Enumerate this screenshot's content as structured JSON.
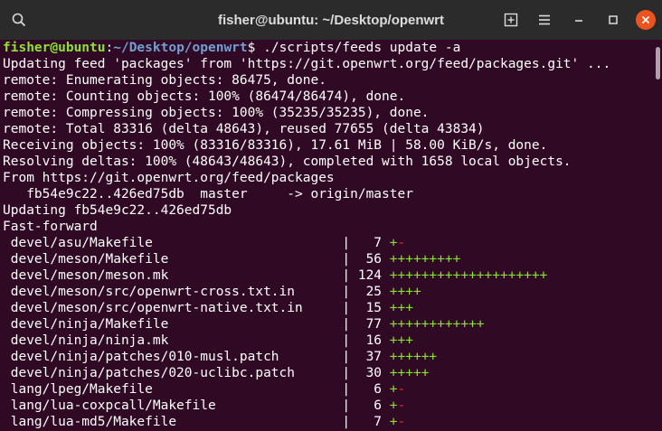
{
  "window": {
    "title": "fisher@ubuntu: ~/Desktop/openwrt",
    "accent": "#e95420",
    "background": "#300a24"
  },
  "prompt": {
    "user_host": "fisher@ubuntu",
    "colon": ":",
    "path": "~/Desktop/openwrt",
    "dollar": "$",
    "command": " ./scripts/feeds update -a"
  },
  "output_lines": [
    "Updating feed 'packages' from 'https://git.openwrt.org/feed/packages.git' ...",
    "remote: Enumerating objects: 86475, done.",
    "remote: Counting objects: 100% (86474/86474), done.",
    "remote: Compressing objects: 100% (35235/35235), done.",
    "remote: Total 83316 (delta 48643), reused 77655 (delta 43834)",
    "Receiving objects: 100% (83316/83316), 17.61 MiB | 58.00 KiB/s, done.",
    "Resolving deltas: 100% (48643/48643), completed with 1658 local objects.",
    "From https://git.openwrt.org/feed/packages",
    "   fb54e9c22..426ed75db  master     -> origin/master",
    "Updating fb54e9c22..426ed75db",
    "Fast-forward"
  ],
  "diffstat": [
    {
      "path": " devel/asu/Makefile                        | ",
      "count": "  7",
      "plus": "+",
      "minus": "-"
    },
    {
      "path": " devel/meson/Makefile                      | ",
      "count": " 56",
      "plus": "+++++++++",
      "minus": ""
    },
    {
      "path": " devel/meson/meson.mk                      | ",
      "count": "124",
      "plus": "++++++++++++++++++++",
      "minus": ""
    },
    {
      "path": " devel/meson/src/openwrt-cross.txt.in      | ",
      "count": " 25",
      "plus": "++++",
      "minus": ""
    },
    {
      "path": " devel/meson/src/openwrt-native.txt.in     | ",
      "count": " 15",
      "plus": "+++",
      "minus": ""
    },
    {
      "path": " devel/ninja/Makefile                      | ",
      "count": " 77",
      "plus": "++++++++++++",
      "minus": ""
    },
    {
      "path": " devel/ninja/ninja.mk                      | ",
      "count": " 16",
      "plus": "+++",
      "minus": ""
    },
    {
      "path": " devel/ninja/patches/010-musl.patch        | ",
      "count": " 37",
      "plus": "++++++",
      "minus": ""
    },
    {
      "path": " devel/ninja/patches/020-uclibc.patch      | ",
      "count": " 30",
      "plus": "+++++",
      "minus": ""
    },
    {
      "path": " lang/lpeg/Makefile                        | ",
      "count": "  6",
      "plus": "+",
      "minus": "-"
    },
    {
      "path": " lang/lua-coxpcall/Makefile                | ",
      "count": "  6",
      "plus": "+",
      "minus": "-"
    },
    {
      "path": " lang/lua-md5/Makefile                     | ",
      "count": "  7",
      "plus": "+",
      "minus": "-"
    }
  ],
  "icons": {
    "search": "search-icon",
    "new_tab": "new-tab-icon",
    "menu": "hamburger-menu-icon",
    "minimize": "minimize-icon",
    "maximize": "maximize-icon",
    "close": "close-icon"
  }
}
